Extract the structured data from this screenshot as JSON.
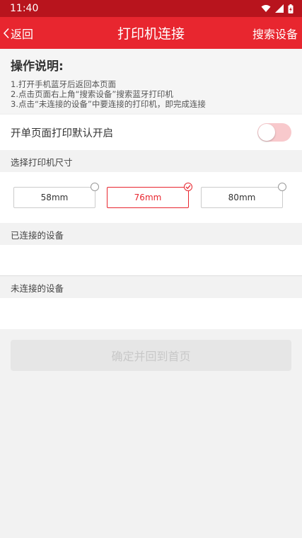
{
  "status_bar": {
    "time": "11:40",
    "icons": [
      "wifi-icon",
      "cell-signal-icon",
      "battery-icon"
    ]
  },
  "app_bar": {
    "back_label": "返回",
    "title": "打印机连接",
    "search_label": "搜索设备"
  },
  "instructions": {
    "title": "操作说明:",
    "lines": [
      "1.打开手机蓝牙后返回本页面",
      "2.点击页面右上角“搜索设备”搜索蓝牙打印机",
      "3.点击“未连接的设备”中要连接的打印机，即完成连接"
    ]
  },
  "auto_print": {
    "label": "开单页面打印默认开启",
    "enabled": false
  },
  "printer_size": {
    "title": "选择打印机尺寸",
    "options": [
      "58mm",
      "76mm",
      "80mm"
    ],
    "selected": "76mm"
  },
  "connected": {
    "title": "已连接的设备",
    "devices": []
  },
  "unconnected": {
    "title": "未连接的设备",
    "devices": []
  },
  "confirm": {
    "label": "确定并回到首页",
    "enabled": false
  },
  "colors": {
    "accent": "#e8262f",
    "status_bar": "#b8141d",
    "background": "#f2f2f2",
    "switch_off_track": "#f8c9cc",
    "disabled_button": "#e6e6e6"
  }
}
